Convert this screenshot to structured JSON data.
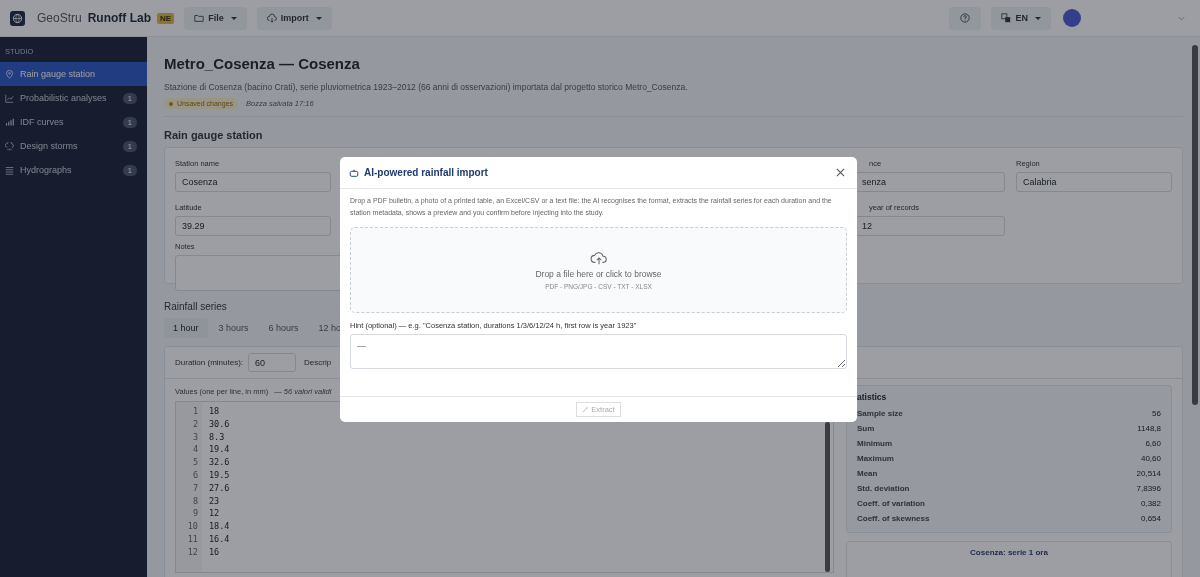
{
  "header": {
    "brand_light": "GeoStru",
    "brand_bold": "Runoff Lab",
    "badge": "NE",
    "menus": [
      {
        "label": "File"
      },
      {
        "label": "Import"
      }
    ],
    "language": "EN"
  },
  "sidebar": {
    "section": "STUDIO",
    "items": [
      {
        "label": "Rain gauge station",
        "selected": true
      },
      {
        "label": "Probabilistic analyses",
        "count": "1",
        "selected": false
      },
      {
        "label": "IDF curves",
        "count": "1",
        "selected": false
      },
      {
        "label": "Design storms",
        "count": "1",
        "selected": false
      },
      {
        "label": "Hydrographs",
        "count": "1",
        "selected": false
      }
    ]
  },
  "page": {
    "title": "Metro_Cosenza — Cosenza",
    "description": "Stazione di Cosenza (bacino Crati), serie pluviometrica 1923–2012 (66 anni di osservazioni) importata dal progetto storico Metro_Cosenza.",
    "status_badge": "Unsaved changes",
    "saved_note": "Bozza salvata 17:16"
  },
  "station": {
    "heading": "Rain gauge station",
    "row_1": [
      {
        "label": "Station name",
        "value": "Cosenza"
      },
      {
        "label": "nce",
        "value": "senza"
      },
      {
        "label": "Region",
        "value": "Calabria"
      }
    ],
    "row_2": [
      {
        "label": "Latitude",
        "value": "39.29"
      },
      {
        "label": "year of records",
        "value": "12"
      }
    ],
    "notes_label": "Notes"
  },
  "series": {
    "heading": "Rainfall series",
    "tabs": [
      {
        "label": "1 hour",
        "selected": true
      },
      {
        "label": "3 hours",
        "selected": false
      },
      {
        "label": "6 hours",
        "selected": false
      },
      {
        "label": "12 ho",
        "selected": false
      }
    ],
    "duration_label": "Duration (minutes):",
    "duration_value": "60",
    "description_label": "Descrip",
    "values_label": "Values (one per line, in mm)",
    "values_note": "— 56 valori validi",
    "lines": [
      {
        "n": "1",
        "value": "18"
      },
      {
        "n": "2",
        "value": "30.6"
      },
      {
        "n": "3",
        "value": "8.3"
      },
      {
        "n": "4",
        "value": "19.4"
      },
      {
        "n": "5",
        "value": "32.6"
      },
      {
        "n": "6",
        "value": "19.5"
      },
      {
        "n": "7",
        "value": "27.6"
      },
      {
        "n": "8",
        "value": "23"
      },
      {
        "n": "9",
        "value": "12"
      },
      {
        "n": "10",
        "value": "18.4"
      },
      {
        "n": "11",
        "value": "16.4"
      },
      {
        "n": "12",
        "value": "16"
      }
    ]
  },
  "statistics": {
    "title": "atistics",
    "rows": [
      {
        "label": "Sample size",
        "value": "56"
      },
      {
        "label": "Sum",
        "value": "1148,8"
      },
      {
        "label": "Minimum",
        "value": "6,60"
      },
      {
        "label": "Maximum",
        "value": "40,60"
      },
      {
        "label": "Mean",
        "value": "20,514"
      },
      {
        "label": "Std. deviation",
        "value": "7,8396"
      },
      {
        "label": "Coeff. of variation",
        "value": "0,382"
      },
      {
        "label": "Coeff. of skewness",
        "value": "0,654"
      }
    ]
  },
  "chart_title": "Cosenza: serie 1 ora",
  "dialog": {
    "title": "AI-powered rainfall import",
    "intro": "Drop a PDF bulletin, a photo of a printed table, an Excel/CSV or a text file: the AI recognises the format, extracts the rainfall series for each duration and the station metadata, shows a preview and you confirm before injecting into the study.",
    "drop_text": "Drop a file here or click to browse",
    "formats": "PDF - PNG/JPG - CSV - TXT - XLSX",
    "hint_label": "Hint (optional) — e.g. \"Cosenza station, durations 1/3/6/12/24 h, first row is year 1923\"",
    "hint_placeholder": "—",
    "extract_button": "Extract",
    "extract_disabled": true
  }
}
